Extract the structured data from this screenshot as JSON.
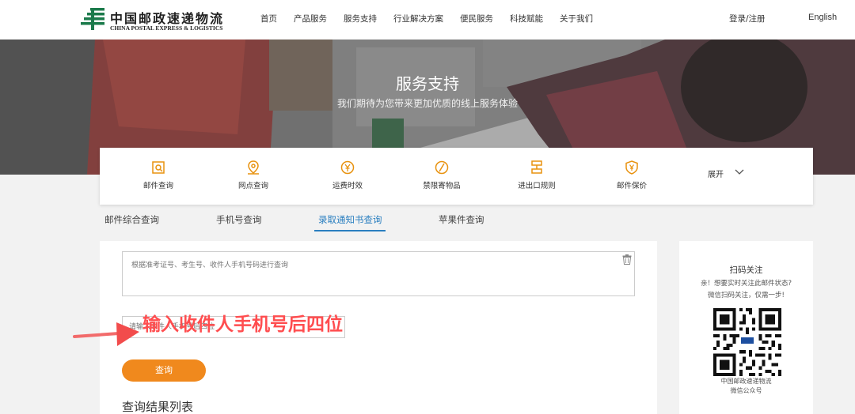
{
  "header": {
    "logo_cn": "中国邮政速递物流",
    "logo_en": "CHINA POSTAL EXPRESS & LOGISTICS",
    "nav": [
      "首页",
      "产品服务",
      "服务支持",
      "行业解决方案",
      "便民服务",
      "科技赋能",
      "关于我们"
    ],
    "login": "登录/注册",
    "language": "English"
  },
  "hero": {
    "title": "服务支持",
    "subtitle": "我们期待为您带来更加优质的线上服务体验"
  },
  "services": {
    "items": [
      {
        "label": "邮件查询",
        "icon": "mail-search-icon"
      },
      {
        "label": "网点查询",
        "icon": "location-pin-icon"
      },
      {
        "label": "运费时效",
        "icon": "yen-clock-icon"
      },
      {
        "label": "禁限寄物品",
        "icon": "prohibited-icon"
      },
      {
        "label": "进出口规则",
        "icon": "import-export-icon"
      },
      {
        "label": "邮件保价",
        "icon": "shield-yen-icon"
      }
    ],
    "expand_label": "展开"
  },
  "tabs": {
    "items": [
      "邮件综合查询",
      "手机号查询",
      "录取通知书查询",
      "苹果件查询"
    ],
    "active": "录取通知书查询"
  },
  "form": {
    "textarea_placeholder": "根据准考证号、考生号、收件人手机号码进行查询",
    "phone_placeholder": "请输入收件人手机号后四位",
    "query_button": "查询",
    "result_title": "查询结果列表"
  },
  "annotation": {
    "text": "输入收件人手机号后四位"
  },
  "qr": {
    "title": "扫码关注",
    "desc_line1": "亲！想要实时关注此邮件状态?",
    "desc_line2": "微信扫码关注，仅需一步!",
    "caption_line1": "中国邮政速递物流",
    "caption_line2": "微信公众号"
  },
  "colors": {
    "brand_green": "#1b7a4b",
    "accent_orange": "#f0891d",
    "active_tab": "#2a7fc0",
    "annotation_red": "#ff4d4f"
  }
}
